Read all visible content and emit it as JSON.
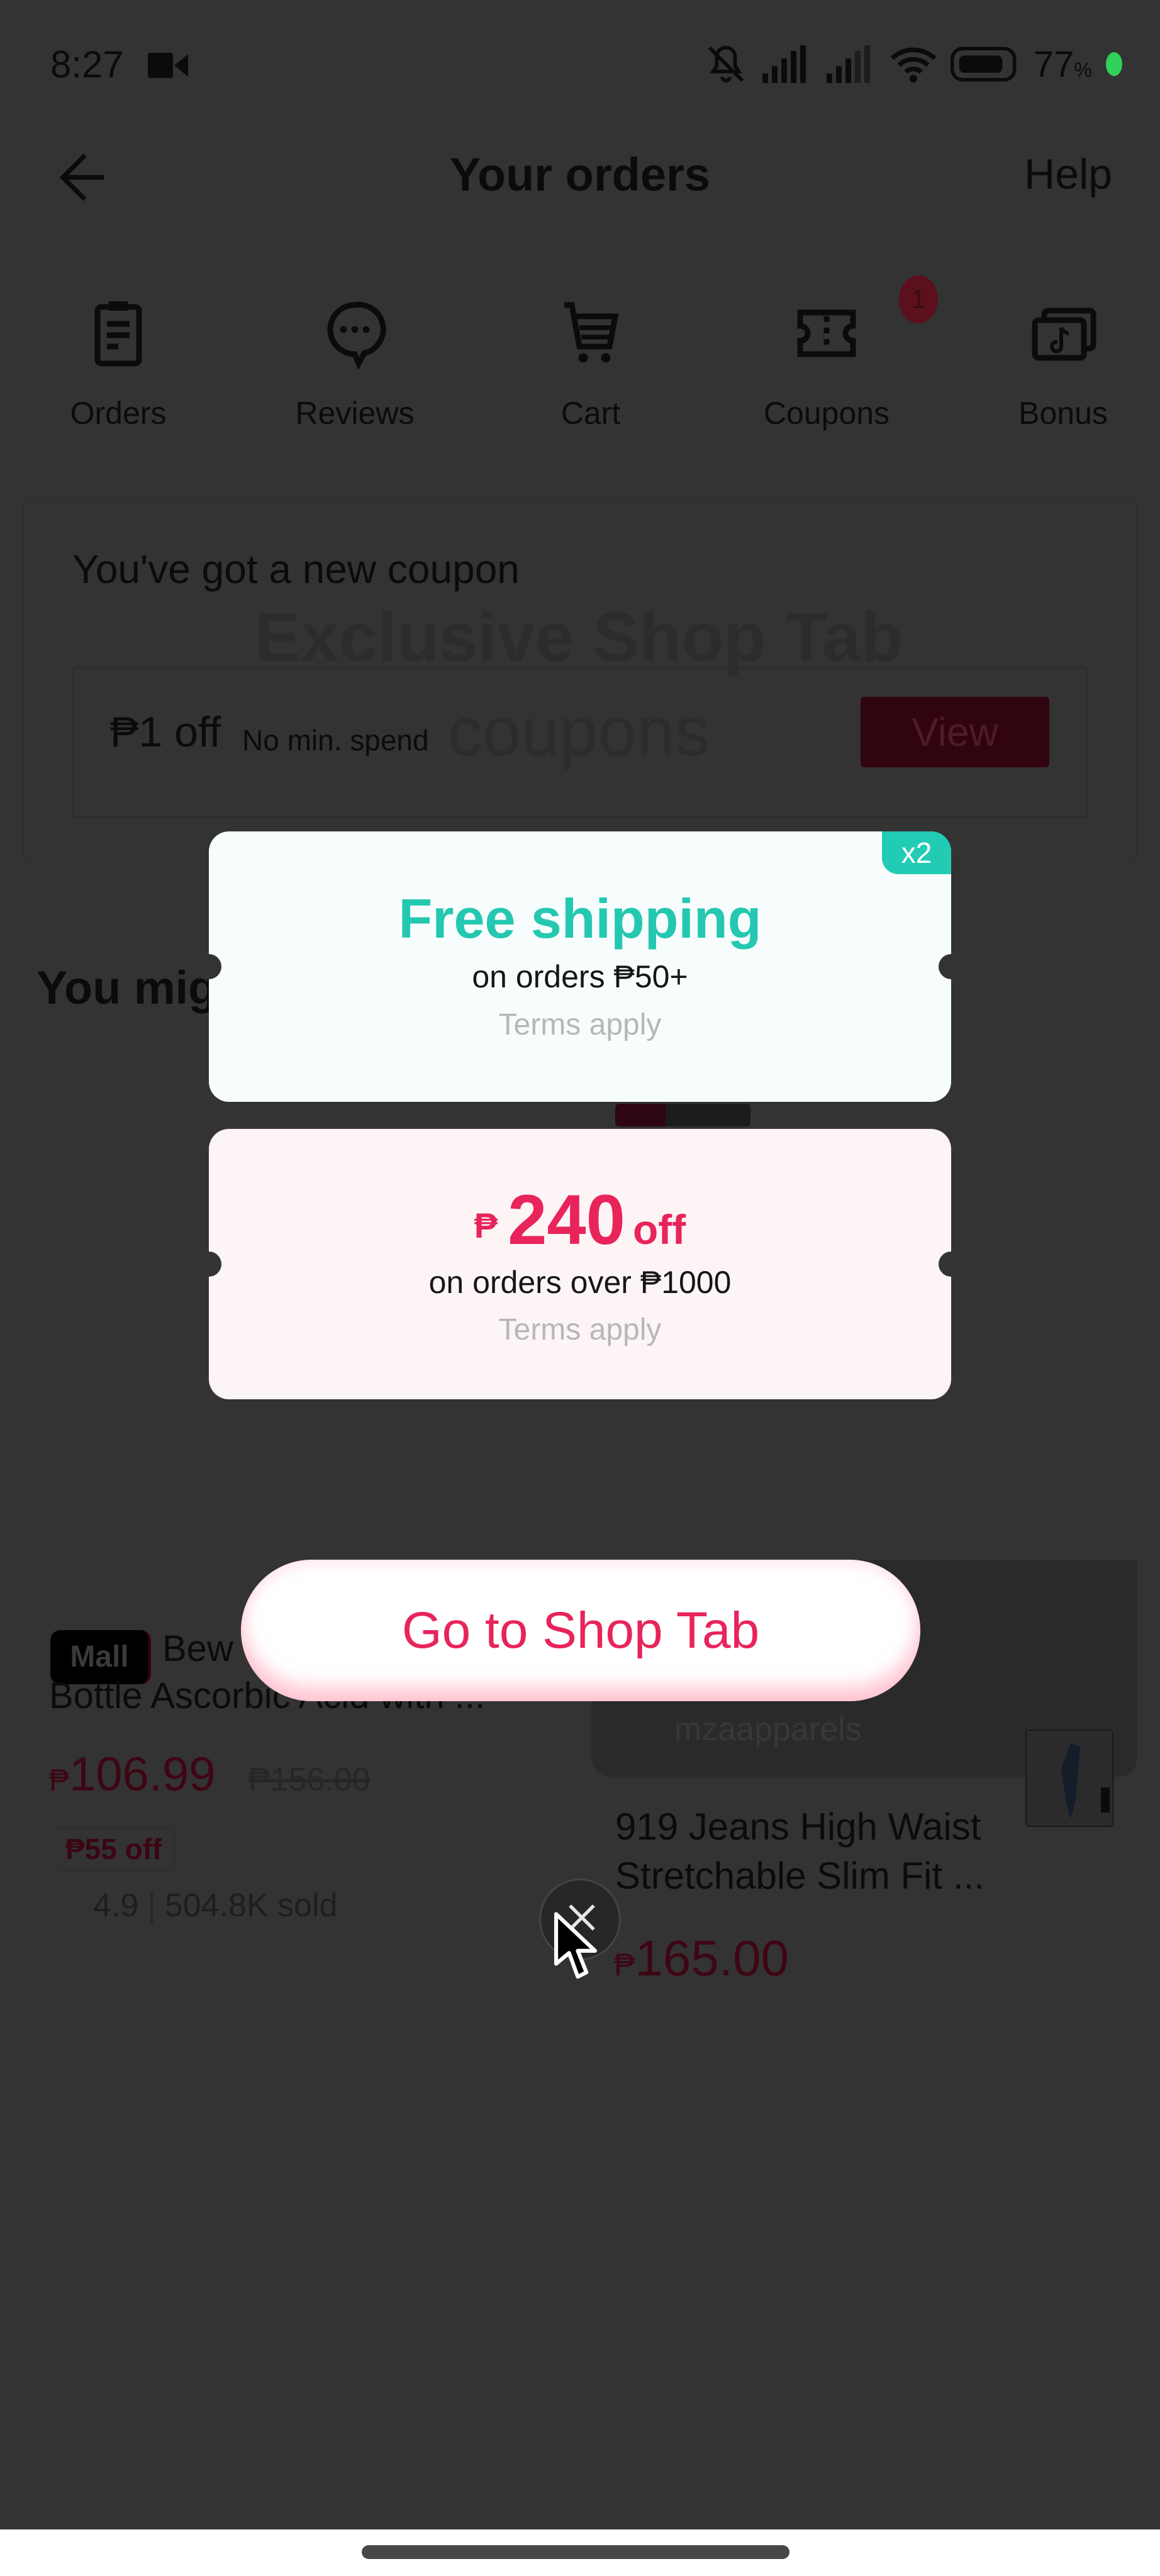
{
  "status_bar": {
    "time": "8:27",
    "battery_percent": "77",
    "battery_suffix": "%",
    "icons": [
      "video-record-icon",
      "mute-icon",
      "signal-icon",
      "signal-icon",
      "wifi-icon",
      "battery-icon"
    ]
  },
  "header": {
    "title": "Your orders",
    "help_label": "Help",
    "back_icon": "arrow-left-icon"
  },
  "nav_shortcuts": [
    {
      "label": "Orders",
      "icon": "clipboard-icon"
    },
    {
      "label": "Reviews",
      "icon": "chat-bubble-icon"
    },
    {
      "label": "Cart",
      "icon": "cart-icon"
    },
    {
      "label": "Coupons",
      "icon": "ticket-icon",
      "badge": "1"
    },
    {
      "label": "Bonus",
      "icon": "bonus-cash-icon"
    }
  ],
  "new_coupon": {
    "heading": "You've got a new coupon",
    "amount": "₱1 off",
    "note": "No min. spend",
    "view_label": "View",
    "ghost_line1": "Exclusive Shop Tab",
    "ghost_line2": "coupons"
  },
  "recommend": {
    "title": "You might like",
    "visible_title": "You mig"
  },
  "products": [
    {
      "badge": "Mall",
      "title_line1": "Bew",
      "title_line2": "Bottle Ascorbic Acid with ...",
      "currency": "₱",
      "price": "106.99",
      "original_price": "₱156.00",
      "discount": "₱55 off",
      "rating": "4.9",
      "sold": "504.8K sold"
    },
    {
      "shop_name": "mzaapparels",
      "title_line1": "919 Jeans High Waist",
      "title_line2": "Stretchable Slim Fit ...",
      "currency": "₱",
      "price": "165.00"
    }
  ],
  "popup": {
    "coupons": [
      {
        "title": "Free shipping",
        "condition": "on orders ₱50+",
        "terms": "Terms apply",
        "multiplier": "x2",
        "accent": "#24c8b0"
      },
      {
        "currency": "₱",
        "amount": "240",
        "suffix": "off",
        "condition": "on orders over ₱1000",
        "terms": "Terms apply",
        "accent": "#e8245a"
      }
    ],
    "cta_label": "Go to Shop Tab",
    "close_icon": "close-icon"
  },
  "colors": {
    "overlay_bg": "#333333",
    "brand_pink": "#e8245a",
    "teal": "#24c8b0"
  }
}
